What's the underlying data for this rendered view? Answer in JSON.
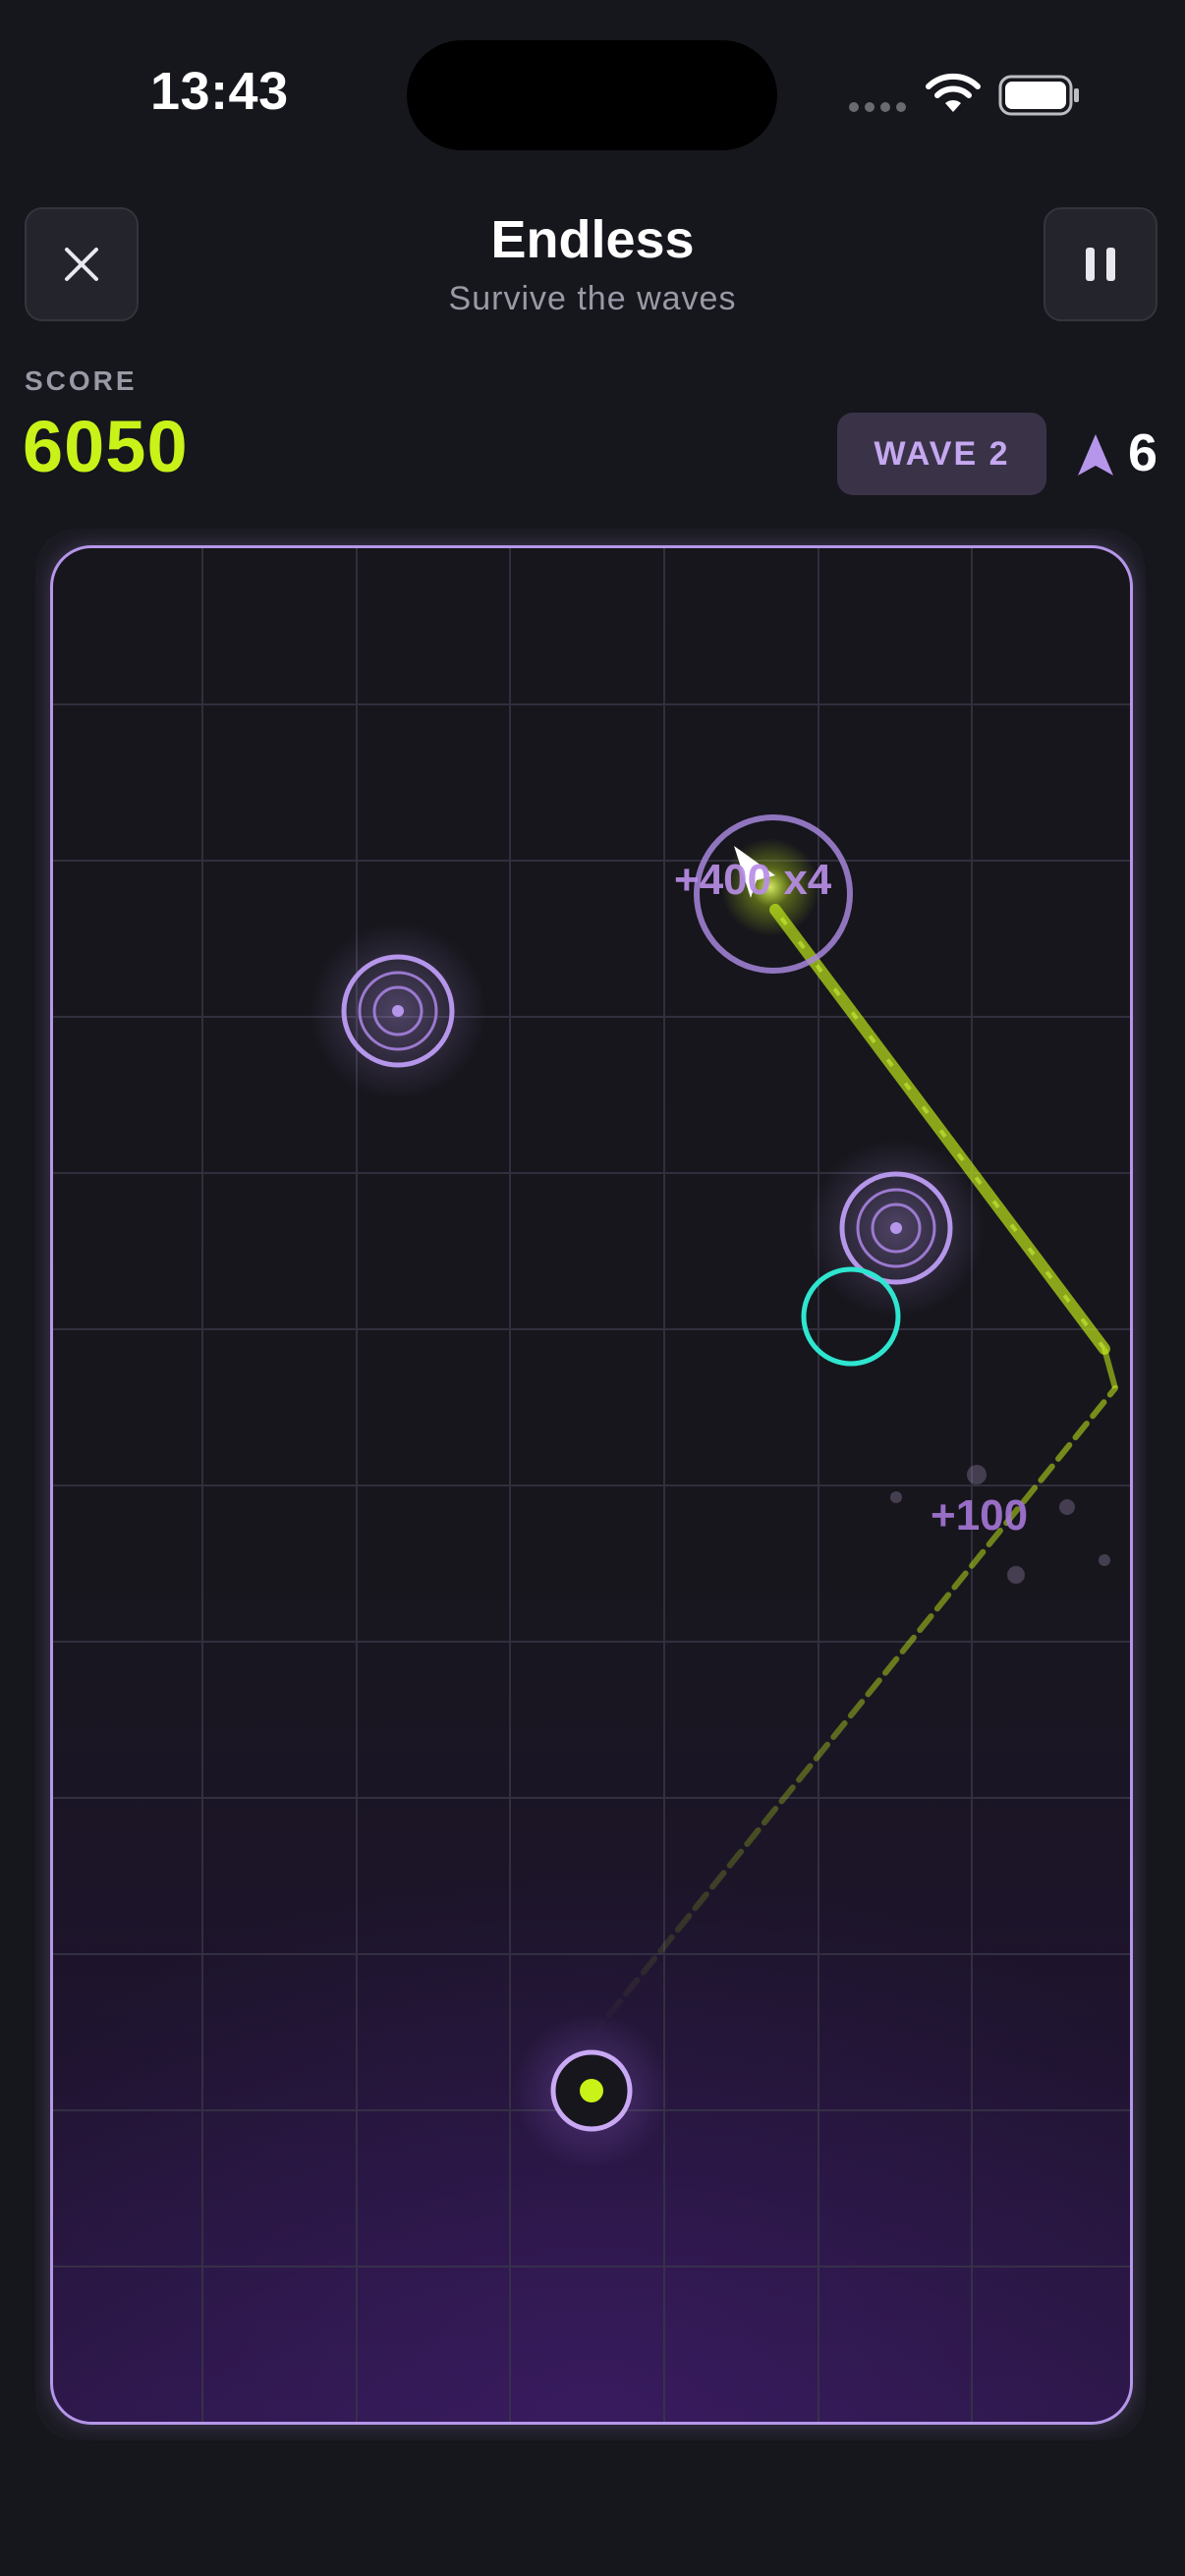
{
  "status_bar": {
    "time": "13:43"
  },
  "header": {
    "title": "Endless",
    "subtitle": "Survive the waves",
    "close_icon": "close-icon",
    "pause_icon": "pause-icon"
  },
  "hud": {
    "score_label": "SCORE",
    "score_value": "6050",
    "wave_label": "WAVE 2",
    "shots_icon": "arrow-shot-icon",
    "shots_remaining": "6"
  },
  "arena": {
    "combo_text": "+400 x4",
    "points_text": "+100"
  },
  "colors": {
    "background": "#16161d",
    "accent_lime": "#c8f218",
    "accent_purple": "#b596ea",
    "cyan_ring": "#2ee6d0",
    "wave_badge_bg": "#3a3348",
    "wave_badge_text": "#c5a8f0"
  }
}
